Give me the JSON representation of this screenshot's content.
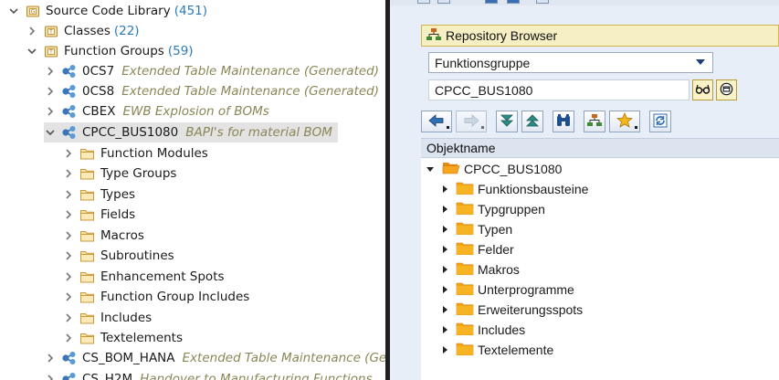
{
  "left_tree": {
    "root": {
      "label": "Source Code Library",
      "count": "(451)"
    },
    "classes": {
      "label": "Classes",
      "count": "(22)"
    },
    "function_groups": {
      "label": "Function Groups",
      "count": "(59)"
    },
    "groups": [
      {
        "label": "0CS7",
        "desc": "Extended Table Maintenance (Generated)"
      },
      {
        "label": "0CS8",
        "desc": "Extended Table Maintenance (Generated)"
      },
      {
        "label": "CBEX",
        "desc": "EWB Explosion of BOMs"
      },
      {
        "label": "CPCC_BUS1080",
        "desc": "BAPI's for material BOM"
      }
    ],
    "children": [
      "Function Modules",
      "Type Groups",
      "Types",
      "Fields",
      "Macros",
      "Subroutines",
      "Enhancement Spots",
      "Function Group Includes",
      "Includes",
      "Textelements"
    ],
    "after": [
      {
        "label": "CS_BOM_HANA",
        "desc": "Extended Table Maintenance (Ge"
      },
      {
        "label": "CS_H2M",
        "desc": "Handover to Manufacturing Functions"
      }
    ]
  },
  "sap": {
    "repository_browser": "Repository Browser",
    "object_type": "Funktionsgruppe",
    "object_name": "CPCC_BUS1080",
    "column_header": "Objektname",
    "tree_root": "CPCC_BUS1080",
    "tree_children": [
      "Funktionsbausteine",
      "Typgruppen",
      "Typen",
      "Felder",
      "Makros",
      "Unterprogramme",
      "Erweiterungsspots",
      "Includes",
      "Textelemente"
    ]
  },
  "colors": {
    "count_blue": "#2a7bb8",
    "desc_olive": "#8a8656",
    "title_bar_yellow": "#f6efc4",
    "sap_background": "#e7eef8"
  }
}
